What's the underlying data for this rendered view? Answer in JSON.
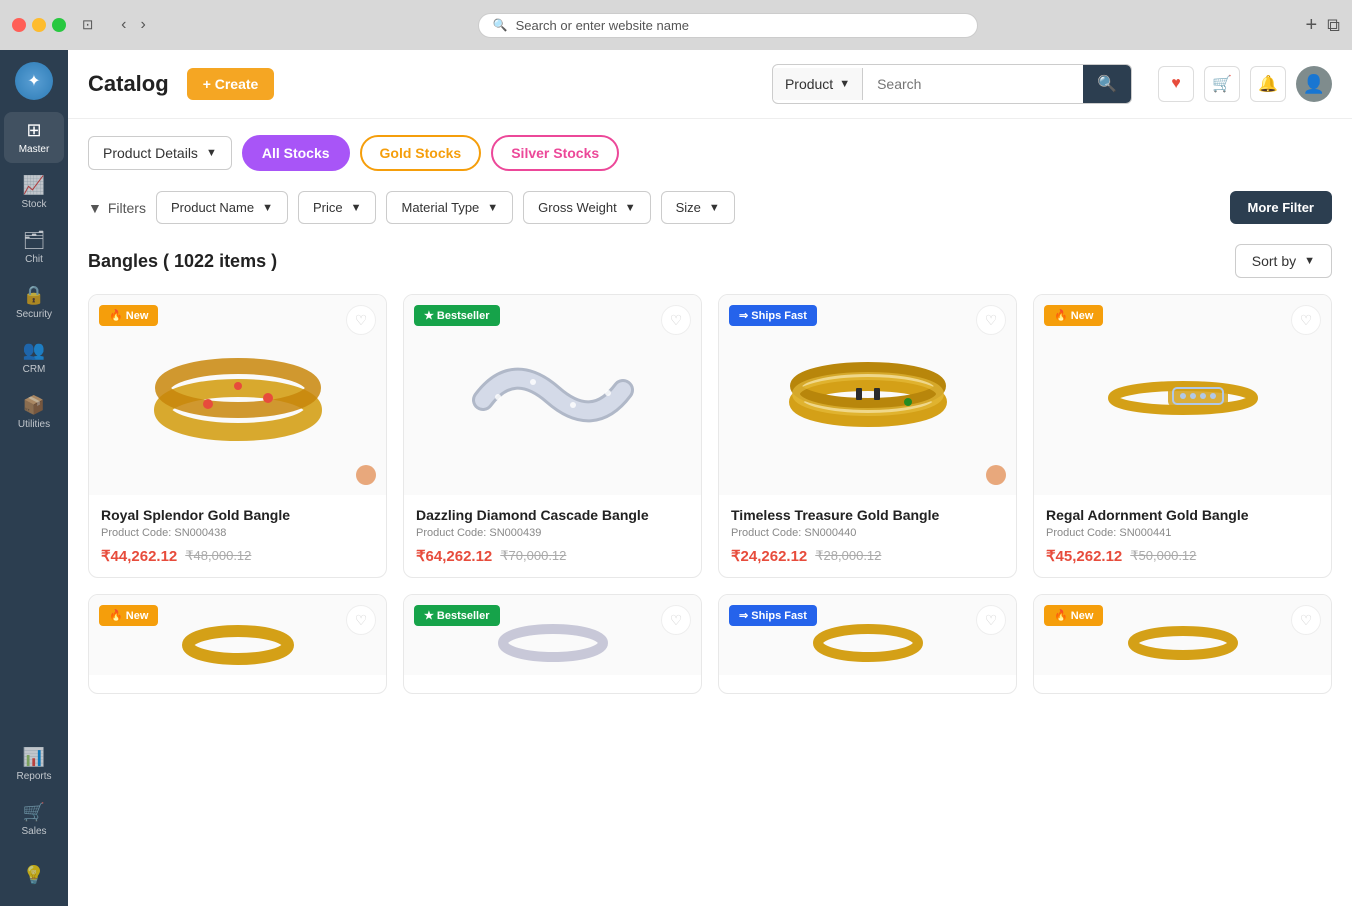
{
  "browser": {
    "address_placeholder": "Search or enter website name"
  },
  "sidebar": {
    "logo_icon": "✦",
    "items": [
      {
        "id": "master",
        "label": "Master",
        "icon": "⊞"
      },
      {
        "id": "stock",
        "label": "Stock",
        "icon": "📈"
      },
      {
        "id": "chit",
        "label": "Chit",
        "icon": "🗂"
      },
      {
        "id": "security",
        "label": "Security",
        "icon": "🔒"
      },
      {
        "id": "crm",
        "label": "CRM",
        "icon": "👥"
      },
      {
        "id": "utilities",
        "label": "Utilities",
        "icon": "📦"
      },
      {
        "id": "reports",
        "label": "Reports",
        "icon": "📊"
      },
      {
        "id": "sales",
        "label": "Sales",
        "icon": "🛒"
      }
    ],
    "bottom_icon": "💡"
  },
  "header": {
    "title": "Catalog",
    "create_label": "+ Create",
    "search_type": "Product",
    "search_placeholder": "Search"
  },
  "tabs": {
    "dropdown_label": "Product Details",
    "all_stocks": "All Stocks",
    "gold_stocks": "Gold Stocks",
    "silver_stocks": "Silver Stocks"
  },
  "filters": {
    "label": "Filters",
    "options": [
      {
        "id": "product-name",
        "label": "Product Name"
      },
      {
        "id": "price",
        "label": "Price"
      },
      {
        "id": "material-type",
        "label": "Material Type"
      },
      {
        "id": "gross-weight",
        "label": "Gross Weight"
      },
      {
        "id": "size",
        "label": "Size"
      }
    ],
    "more_label": "More Filter"
  },
  "section": {
    "title": "Bangles ( 1022 items )",
    "sort_label": "Sort by"
  },
  "products": [
    {
      "id": 1,
      "badge_type": "new",
      "badge_label": "🔥 New",
      "name": "Royal Splendor Gold Bangle",
      "code": "Product Code: SN000438",
      "price": "₹44,262.12",
      "original_price": "₹48,000.12",
      "color_dot": "#e8a87c",
      "shape": "gold_ornate"
    },
    {
      "id": 2,
      "badge_type": "bestseller",
      "badge_label": "★ Bestseller",
      "name": "Dazzling Diamond Cascade Bangle",
      "code": "Product Code: SN000439",
      "price": "₹64,262.12",
      "original_price": "₹70,000.12",
      "color_dot": "#c0c0c0",
      "shape": "silver_wave"
    },
    {
      "id": 3,
      "badge_type": "shipsfast",
      "badge_label": "⇒ Ships Fast",
      "name": "Timeless Treasure Gold Bangle",
      "code": "Product Code: SN000440",
      "price": "₹24,262.12",
      "original_price": "₹28,000.12",
      "color_dot": "#e8a87c",
      "shape": "gold_plain"
    },
    {
      "id": 4,
      "badge_type": "new",
      "badge_label": "🔥 New",
      "name": "Regal Adornment Gold Bangle",
      "code": "Product Code: SN000441",
      "price": "₹45,262.12",
      "original_price": "₹50,000.12",
      "color_dot": "#c0c0c0",
      "shape": "gold_diamond"
    }
  ],
  "products_row2": [
    {
      "id": 5,
      "badge_type": "new",
      "badge_label": "🔥 New",
      "name": "",
      "code": "",
      "price": "",
      "original_price": ""
    },
    {
      "id": 6,
      "badge_type": "bestseller",
      "badge_label": "★ Bestseller",
      "name": "",
      "code": "",
      "price": "",
      "original_price": ""
    },
    {
      "id": 7,
      "badge_type": "shipsfast",
      "badge_label": "⇒ Ships Fast",
      "name": "",
      "code": "",
      "price": "",
      "original_price": ""
    },
    {
      "id": 8,
      "badge_type": "new",
      "badge_label": "🔥 New",
      "name": "",
      "code": "",
      "price": "",
      "original_price": ""
    }
  ]
}
